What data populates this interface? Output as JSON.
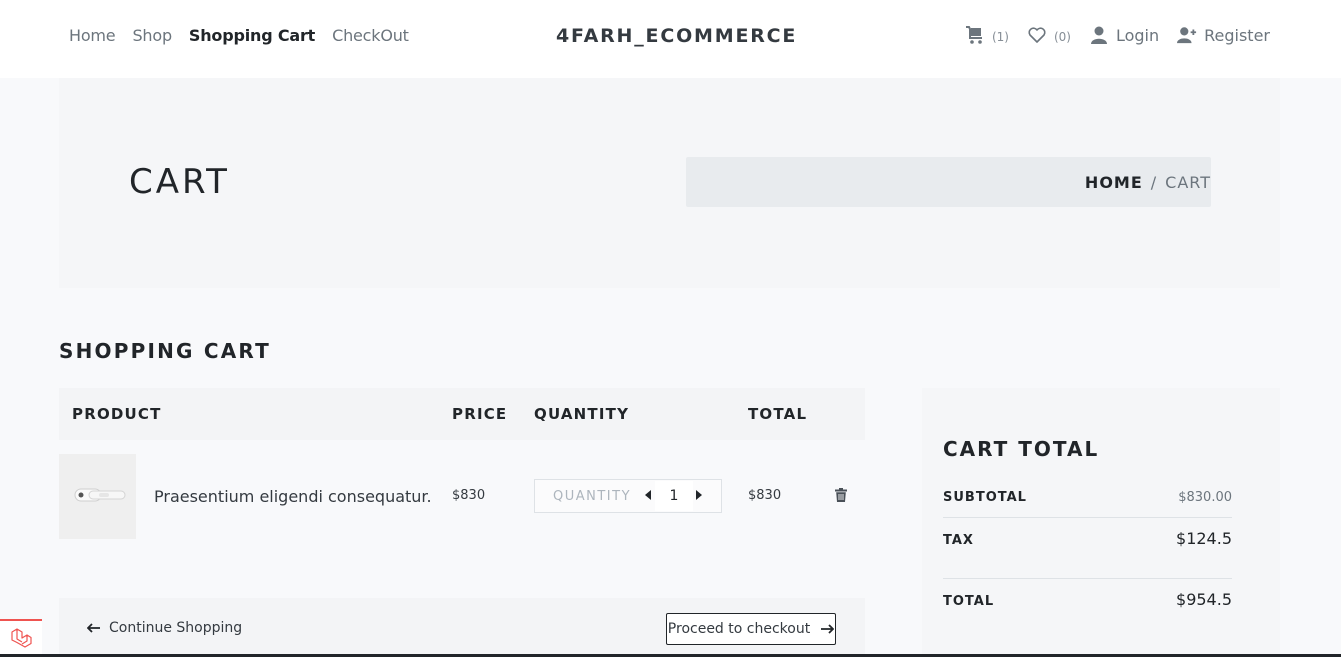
{
  "nav": {
    "items": [
      {
        "label": "Home",
        "active": false
      },
      {
        "label": "Shop",
        "active": false
      },
      {
        "label": "Shopping Cart",
        "active": true
      },
      {
        "label": "CheckOut",
        "active": false
      }
    ]
  },
  "brand": "4FARH_ECOMMERCE",
  "header_right": {
    "cart_icon": "cart-icon",
    "cart_count": "(1)",
    "wishlist_icon": "heart-icon",
    "wishlist_count": "(0)",
    "login_icon": "user-icon",
    "login_label": "Login",
    "register_icon": "user-plus-icon",
    "register_label": "Register"
  },
  "hero": {
    "title": "CART",
    "breadcrumb": {
      "home": "HOME",
      "separator": "/",
      "current": "CART"
    }
  },
  "cart": {
    "section_title": "SHOPPING CART",
    "columns": {
      "product": "PRODUCT",
      "price": "PRICE",
      "quantity": "QUANTITY",
      "total": "TOTAL"
    },
    "items": [
      {
        "image": "earbuds-product-image",
        "name": "Praesentium eligendi consequatur.",
        "price": "$830",
        "quantity_label": "QUANTITY",
        "quantity": "1",
        "total": "$830"
      }
    ],
    "continue_label": "Continue Shopping",
    "checkout_label": "Proceed to checkout"
  },
  "totals": {
    "title": "CART TOTAL",
    "subtotal_label": "SUBTOTAL",
    "subtotal_value": "$830.00",
    "tax_label": "TAX",
    "tax_value": "$124.5",
    "total_label": "TOTAL",
    "total_value": "$954.5"
  },
  "colors": {
    "accent": "#212529",
    "muted": "#6c757d",
    "background": "#f8f9fb",
    "laravel_red": "#ef5350"
  }
}
